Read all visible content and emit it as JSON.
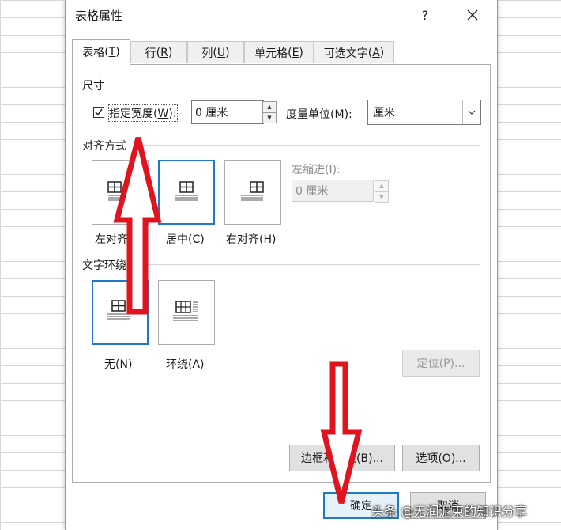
{
  "dialog": {
    "title": "表格属性",
    "help": "?",
    "tabs": [
      {
        "label": "表格",
        "key": "T"
      },
      {
        "label": "行",
        "key": "R"
      },
      {
        "label": "列",
        "key": "U"
      },
      {
        "label": "单元格",
        "key": "E"
      },
      {
        "label": "可选文字",
        "key": "A"
      }
    ]
  },
  "size": {
    "section": "尺寸",
    "checkbox_label": "指定宽度",
    "checkbox_key": "W",
    "checkbox_checked": true,
    "width_value": "0 厘米",
    "unit_label": "度量单位",
    "unit_key": "M",
    "unit_value": "厘米"
  },
  "align": {
    "section": "对齐方式",
    "options": [
      {
        "label": "左对齐",
        "key": "L",
        "selected": false
      },
      {
        "label": "居中",
        "key": "C",
        "selected": true
      },
      {
        "label": "右对齐",
        "key": "H",
        "selected": false
      }
    ],
    "indent_label": "左缩进(I):",
    "indent_value": "0 厘米"
  },
  "wrap": {
    "section": "文字环绕",
    "options": [
      {
        "label": "无",
        "key": "N",
        "selected": true
      },
      {
        "label": "环绕",
        "key": "A",
        "selected": false
      }
    ],
    "position_button": "定位(P)..."
  },
  "buttons": {
    "borders": "边框和底纹(B)...",
    "options": "选项(O)...",
    "ok": "确定",
    "cancel": "取消"
  },
  "watermark": "头条 @无润泥束的知识分享",
  "colors": {
    "accent": "#1f78c8",
    "annotation_arrow": "#e0141e"
  }
}
